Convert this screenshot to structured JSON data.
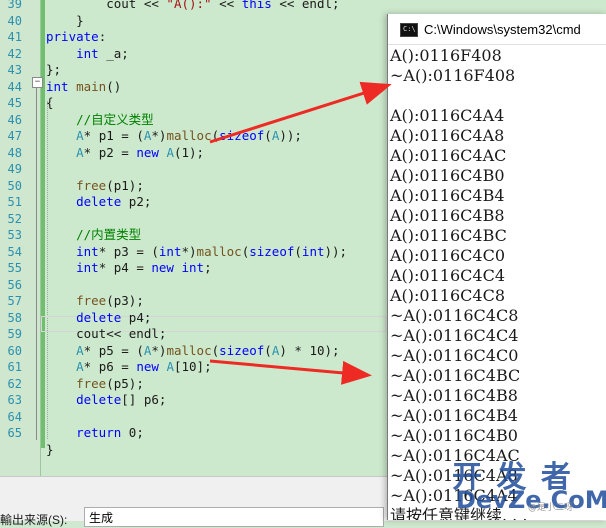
{
  "editor": {
    "line_numbers": [
      "39",
      "40",
      "41",
      "42",
      "43",
      "44",
      "45",
      "46",
      "47",
      "48",
      "49",
      "50",
      "51",
      "52",
      "53",
      "54",
      "55",
      "56",
      "57",
      "58",
      "59",
      "60",
      "61",
      "62",
      "63",
      "64",
      "65"
    ],
    "lines": [
      [
        {
          "t": "        cout << ",
          "c": ""
        },
        {
          "t": "\"A():\"",
          "c": "st"
        },
        {
          "t": " << ",
          "c": ""
        },
        {
          "t": "this",
          "c": "kw"
        },
        {
          "t": " << endl;",
          "c": ""
        }
      ],
      [
        {
          "t": "    }",
          "c": ""
        }
      ],
      [
        {
          "t": "private",
          "c": "kw"
        },
        {
          "t": ":",
          "c": ""
        }
      ],
      [
        {
          "t": "    ",
          "c": ""
        },
        {
          "t": "int",
          "c": "kw"
        },
        {
          "t": " _a;",
          "c": ""
        }
      ],
      [
        {
          "t": "};",
          "c": ""
        }
      ],
      [
        {
          "t": "int",
          "c": "kw"
        },
        {
          "t": " ",
          "c": ""
        },
        {
          "t": "main",
          "c": "fn"
        },
        {
          "t": "()",
          "c": ""
        }
      ],
      [
        {
          "t": "{",
          "c": ""
        }
      ],
      [
        {
          "t": "    ",
          "c": ""
        },
        {
          "t": "//自定义类型",
          "c": "cm"
        }
      ],
      [
        {
          "t": "    ",
          "c": ""
        },
        {
          "t": "A",
          "c": "ty"
        },
        {
          "t": "* p1 = (",
          "c": ""
        },
        {
          "t": "A",
          "c": "ty"
        },
        {
          "t": "*)",
          "c": ""
        },
        {
          "t": "malloc",
          "c": "fn"
        },
        {
          "t": "(",
          "c": ""
        },
        {
          "t": "sizeof",
          "c": "kw"
        },
        {
          "t": "(",
          "c": ""
        },
        {
          "t": "A",
          "c": "ty"
        },
        {
          "t": "));",
          "c": ""
        }
      ],
      [
        {
          "t": "    ",
          "c": ""
        },
        {
          "t": "A",
          "c": "ty"
        },
        {
          "t": "* p2 = ",
          "c": ""
        },
        {
          "t": "new",
          "c": "kw"
        },
        {
          "t": " ",
          "c": ""
        },
        {
          "t": "A",
          "c": "ty"
        },
        {
          "t": "(1);",
          "c": ""
        }
      ],
      [
        {
          "t": "",
          "c": ""
        }
      ],
      [
        {
          "t": "    ",
          "c": ""
        },
        {
          "t": "free",
          "c": "fn"
        },
        {
          "t": "(p1);",
          "c": ""
        }
      ],
      [
        {
          "t": "    ",
          "c": ""
        },
        {
          "t": "delete",
          "c": "kw"
        },
        {
          "t": " p2;",
          "c": ""
        }
      ],
      [
        {
          "t": "",
          "c": ""
        }
      ],
      [
        {
          "t": "    ",
          "c": ""
        },
        {
          "t": "//内置类型",
          "c": "cm"
        }
      ],
      [
        {
          "t": "    ",
          "c": ""
        },
        {
          "t": "int",
          "c": "kw"
        },
        {
          "t": "* p3 = (",
          "c": ""
        },
        {
          "t": "int",
          "c": "kw"
        },
        {
          "t": "*)",
          "c": ""
        },
        {
          "t": "malloc",
          "c": "fn"
        },
        {
          "t": "(",
          "c": ""
        },
        {
          "t": "sizeof",
          "c": "kw"
        },
        {
          "t": "(",
          "c": ""
        },
        {
          "t": "int",
          "c": "kw"
        },
        {
          "t": "));",
          "c": ""
        }
      ],
      [
        {
          "t": "    ",
          "c": ""
        },
        {
          "t": "int",
          "c": "kw"
        },
        {
          "t": "* p4 = ",
          "c": ""
        },
        {
          "t": "new",
          "c": "kw"
        },
        {
          "t": " ",
          "c": ""
        },
        {
          "t": "int",
          "c": "kw"
        },
        {
          "t": ";",
          "c": ""
        }
      ],
      [
        {
          "t": "",
          "c": ""
        }
      ],
      [
        {
          "t": "    ",
          "c": ""
        },
        {
          "t": "free",
          "c": "fn"
        },
        {
          "t": "(p3);",
          "c": ""
        }
      ],
      [
        {
          "t": "    ",
          "c": ""
        },
        {
          "t": "delete",
          "c": "kw"
        },
        {
          "t": " p4;",
          "c": ""
        }
      ],
      [
        {
          "t": "    cout<< endl;",
          "c": ""
        }
      ],
      [
        {
          "t": "    ",
          "c": ""
        },
        {
          "t": "A",
          "c": "ty"
        },
        {
          "t": "* p5 = (",
          "c": ""
        },
        {
          "t": "A",
          "c": "ty"
        },
        {
          "t": "*)",
          "c": ""
        },
        {
          "t": "malloc",
          "c": "fn"
        },
        {
          "t": "(",
          "c": ""
        },
        {
          "t": "sizeof",
          "c": "kw"
        },
        {
          "t": "(",
          "c": ""
        },
        {
          "t": "A",
          "c": "ty"
        },
        {
          "t": ") * 10);",
          "c": ""
        }
      ],
      [
        {
          "t": "    ",
          "c": ""
        },
        {
          "t": "A",
          "c": "ty"
        },
        {
          "t": "* p6 = ",
          "c": ""
        },
        {
          "t": "new",
          "c": "kw"
        },
        {
          "t": " ",
          "c": ""
        },
        {
          "t": "A",
          "c": "ty"
        },
        {
          "t": "[10];",
          "c": ""
        }
      ],
      [
        {
          "t": "    ",
          "c": ""
        },
        {
          "t": "free",
          "c": "fn"
        },
        {
          "t": "(p5);",
          "c": ""
        }
      ],
      [
        {
          "t": "    ",
          "c": ""
        },
        {
          "t": "delete",
          "c": "kw"
        },
        {
          "t": "[] p6;",
          "c": ""
        }
      ],
      [
        {
          "t": "",
          "c": ""
        }
      ],
      [
        {
          "t": "    ",
          "c": ""
        },
        {
          "t": "return",
          "c": "kw"
        },
        {
          "t": " 0;",
          "c": ""
        }
      ],
      [
        {
          "t": "}",
          "c": ""
        }
      ]
    ]
  },
  "bottom_panel": {
    "label": "輸出来源(S):",
    "source_value": "生成"
  },
  "console": {
    "title": "C:\\Windows\\system32\\cmd",
    "output": [
      "A():0116F408",
      "~A():0116F408",
      "",
      "A():0116C4A4",
      "A():0116C4A8",
      "A():0116C4AC",
      "A():0116C4B0",
      "A():0116C4B4",
      "A():0116C4B8",
      "A():0116C4BC",
      "A():0116C4C0",
      "A():0116C4C4",
      "A():0116C4C8",
      "~A():0116C4C8",
      "~A():0116C4C4",
      "~A():0116C4C0",
      "~A():0116C4BC",
      "~A():0116C4B8",
      "~A():0116C4B4",
      "~A():0116C4B0",
      "~A():0116C4AC",
      "~A():0116C4A8",
      "~A():0116C4A4",
      "请按任意键继续. . ."
    ]
  },
  "watermark": {
    "cn": "开 发 者",
    "en": "DevZe.CoM",
    "tag": "@是小二呀"
  },
  "colors": {
    "arrow": "#ee2a24",
    "editor_bg": "#cde9cd"
  }
}
